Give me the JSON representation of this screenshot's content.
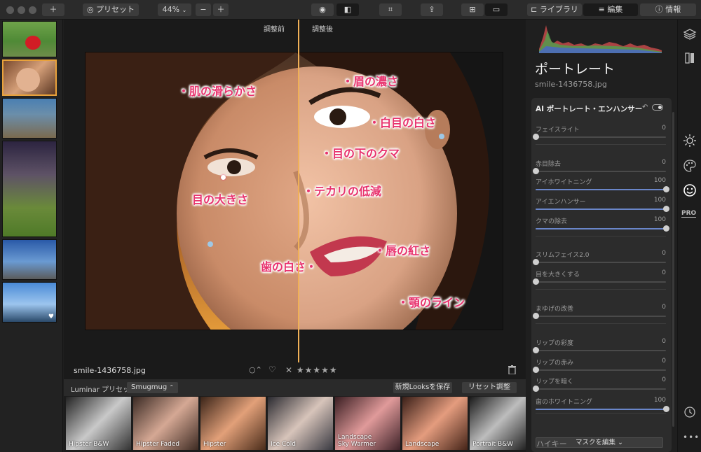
{
  "toolbar": {
    "preset_label": "プリセット",
    "zoom_label": "44%",
    "library_label": "ライブラリ",
    "edit_label": "編集",
    "info_label": "情報"
  },
  "canvas": {
    "before_label": "調整前",
    "after_label": "調整後"
  },
  "callouts": {
    "skin_smoothing": "・肌の滑らかさ",
    "brow_darken": "・眉の濃さ",
    "eye_whitening": "・白目の白さ",
    "dark_circles": "・目の下のクマ",
    "eye_enlarge": "目の大きさ",
    "shine_reduce": "・テカリの低減",
    "lip_redness": "・唇の紅さ",
    "teeth_whitening": "歯の白さ・",
    "jaw_line": "・顎のライン"
  },
  "infobar": {
    "filename": "smile-1436758.jpg",
    "stars": "✕ ★★★★★"
  },
  "presetbar": {
    "label": "Luminar プリセット",
    "collection": "Smugmug",
    "save_looks": "新規Looksを保存",
    "reset": "リセット調整"
  },
  "presets": [
    {
      "label": "Hipster B&W"
    },
    {
      "label": "Hipster Faded"
    },
    {
      "label": "Hipster"
    },
    {
      "label": "Ice Cold"
    },
    {
      "label": "Landscape\nSky Warmer"
    },
    {
      "label": "Landscape"
    },
    {
      "label": "Portrait B&W"
    }
  ],
  "panel": {
    "title": "ポートレート",
    "filename": "smile-1436758.jpg",
    "tool_title": "AI ポートレート・エンハンサー",
    "mask_button": "マスクを編集 ⌄",
    "next_tool": "ハイキー",
    "sliders": [
      {
        "label": "フェイスライト",
        "value": "0",
        "level": 0
      },
      {
        "label": "赤目除去",
        "value": "0",
        "level": 0
      },
      {
        "label": "アイホワイトニング",
        "value": "100",
        "level": 1
      },
      {
        "label": "アイエンハンサー",
        "value": "100",
        "level": 1
      },
      {
        "label": "クマの除去",
        "value": "100",
        "level": 1
      },
      {
        "label": "スリムフェイス2.0",
        "value": "0",
        "level": 0
      },
      {
        "label": "目を大きくする",
        "value": "0",
        "level": 0
      },
      {
        "label": "まゆげの改善",
        "value": "0",
        "level": 0
      },
      {
        "label": "リップの彩度",
        "value": "0",
        "level": 0
      },
      {
        "label": "リップの赤み",
        "value": "0",
        "level": 0
      },
      {
        "label": "リップを暗く",
        "value": "0",
        "level": 0
      },
      {
        "label": "歯のホワイトニング",
        "value": "100",
        "level": 1
      }
    ]
  },
  "iconbar": {
    "pro_label": "PRO"
  }
}
